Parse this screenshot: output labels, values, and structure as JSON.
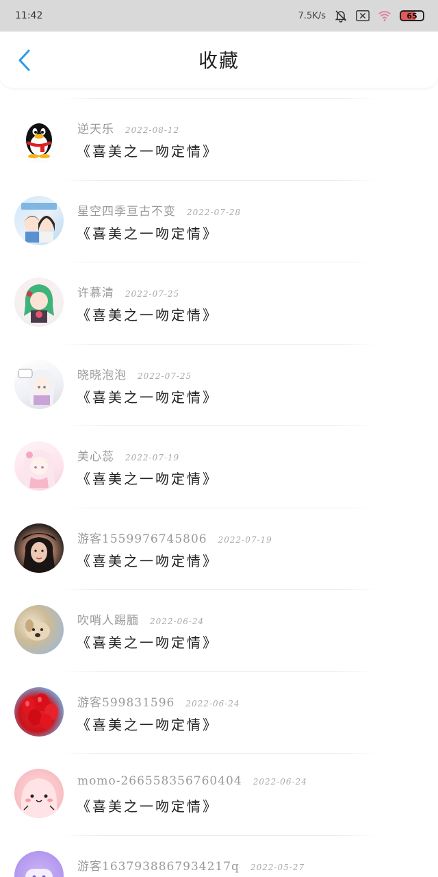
{
  "status_bar": {
    "time": "11:42",
    "net_speed": "7.5K/s",
    "battery": "65",
    "icons": [
      "bell-muted-icon",
      "sim-blocked-icon",
      "wifi-icon",
      "battery-icon"
    ]
  },
  "header": {
    "back_icon": "chevron-left-icon",
    "title": "收藏",
    "accent": "#2b9be8"
  },
  "favorites": [
    {
      "name": "逆天乐",
      "date": "2022-08-12",
      "work": "《喜美之一吻定情》",
      "avatar": "qq-penguin"
    },
    {
      "name": "星空四季亘古不变",
      "date": "2022-07-28",
      "work": "《喜美之一吻定情》",
      "avatar": "anime-couple"
    },
    {
      "name": "许慕清",
      "date": "2022-07-25",
      "work": "《喜美之一吻定情》",
      "avatar": "green-hair-girl"
    },
    {
      "name": "晓晓泡泡",
      "date": "2022-07-25",
      "work": "《喜美之一吻定情》",
      "avatar": "white-hair-anime"
    },
    {
      "name": "美心蕊",
      "date": "2022-07-19",
      "work": "《喜美之一吻定情》",
      "avatar": "pink-anime-girl"
    },
    {
      "name": "游客1559976745806",
      "date": "2022-07-19",
      "work": "《喜美之一吻定情》",
      "avatar": "woman-photo"
    },
    {
      "name": "吹哨人踢腼",
      "date": "2022-06-24",
      "work": "《喜美之一吻定情》",
      "avatar": "dog-photo"
    },
    {
      "name": "游客599831596",
      "date": "2022-06-24",
      "work": "《喜美之一吻定情》",
      "avatar": "red-balloons"
    },
    {
      "name": "momo-266558356760404",
      "date": "2022-06-24",
      "work": "《喜美之一吻定情》",
      "avatar": "pink-blob"
    },
    {
      "name": "游客1637938867934217q",
      "date": "2022-05-27",
      "work": "",
      "avatar": "purple-blob"
    }
  ]
}
